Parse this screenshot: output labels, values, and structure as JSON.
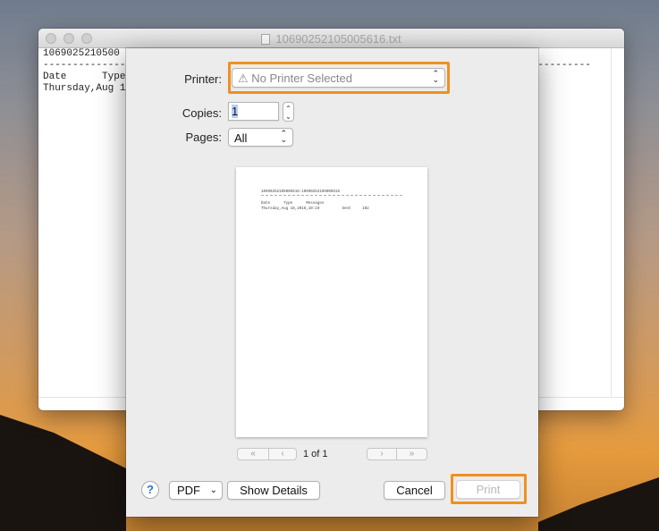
{
  "document_window": {
    "title": "10690252105005616.txt",
    "lines": [
      "1069025210500",
      "--------------",
      "Date      Type",
      "Thursday,Aug 1"
    ],
    "right_line": "-----------------------"
  },
  "print_dialog": {
    "printer_label": "Printer:",
    "printer_value": "No Printer Selected",
    "copies_label": "Copies:",
    "copies_value": "1",
    "pages_label": "Pages:",
    "pages_value": "All",
    "preview_lines": [
      "10690252105005616:10690252105005616",
      "Date      Type      Messages",
      "Thursday,Aug 18,2016,10:19          Sent     102"
    ],
    "page_indicator": "1 of 1",
    "help_label": "?",
    "pdf_label": "PDF",
    "show_details_label": "Show Details",
    "cancel_label": "Cancel",
    "print_label": "Print"
  }
}
